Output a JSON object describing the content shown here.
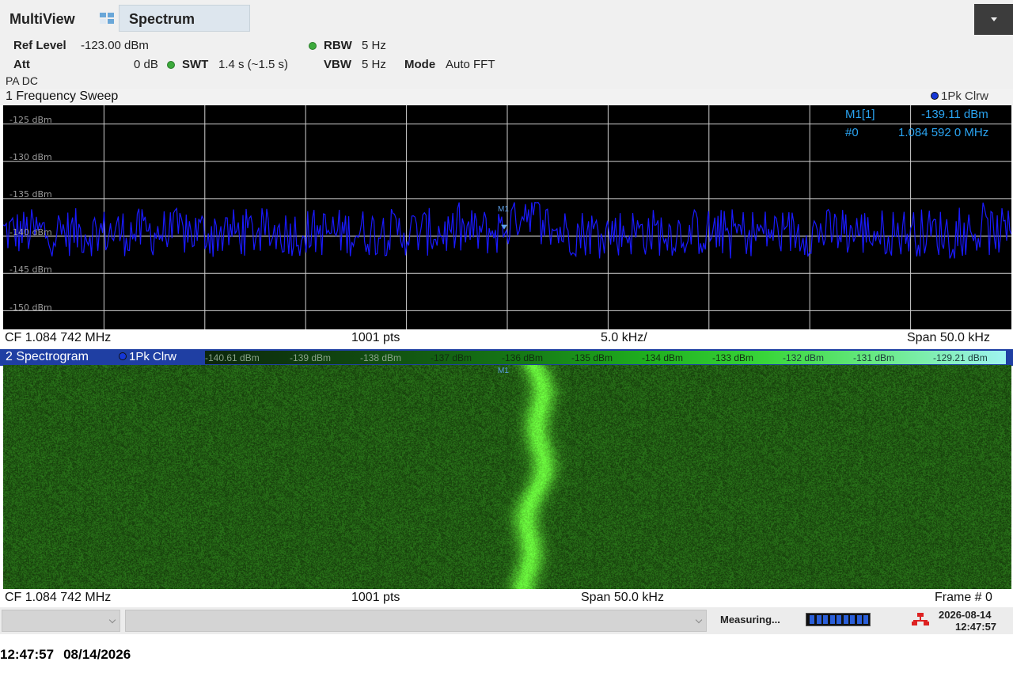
{
  "app": {
    "title": "MultiView",
    "active_tab": "Spectrum"
  },
  "settings": {
    "ref_level_label": "Ref Level",
    "ref_level_value": "-123.00 dBm",
    "att_label": "Att",
    "att_value": "0 dB",
    "swt_label": "SWT",
    "swt_value": "1.4 s (~1.5 s)",
    "rbw_label": "RBW",
    "rbw_value": "5 Hz",
    "vbw_label": "VBW",
    "vbw_value": "5 Hz",
    "mode_label": "Mode",
    "mode_value": "Auto FFT",
    "coupling": "PA DC"
  },
  "window1": {
    "title": "1 Frequency Sweep",
    "trace": "1Pk Clrw",
    "y_labels": [
      "-125 dBm",
      "-130 dBm",
      "-135 dBm",
      "-140 dBm",
      "-145 dBm",
      "-150 dBm"
    ],
    "marker": {
      "name": "M1[1]",
      "level": "-139.11 dBm",
      "index": "#0",
      "freq": "1.084 592 0 MHz",
      "label": "M1"
    },
    "footer": {
      "cf": "CF 1.084 742 MHz",
      "pts": "1001 pts",
      "div": "5.0 kHz/",
      "span": "Span 50.0 kHz"
    }
  },
  "window2": {
    "title": "2 Spectrogram",
    "trace": "1Pk Clrw",
    "colorbar_labels": [
      "-140.61 dBm",
      "-139 dBm",
      "-138 dBm",
      "-137 dBm",
      "-136 dBm",
      "-135 dBm",
      "-134 dBm",
      "-133 dBm",
      "-132 dBm",
      "-131 dBm",
      "-129.21 dBm"
    ],
    "marker_label": "M1",
    "footer": {
      "cf": "CF 1.084 742 MHz",
      "pts": "1001 pts",
      "span": "Span 50.0 kHz",
      "frame": "Frame # 0"
    }
  },
  "status": {
    "measuring": "Measuring...",
    "date": "2026-08-14",
    "time": "12:47:57"
  },
  "bottom": {
    "time": "12:47:57",
    "date": "08/14/2026"
  },
  "colors": {
    "trace": "#1a1aff",
    "plot_bg": "#000000",
    "grid": "#cfcfcf",
    "spectrogram_base": "#2c5a1d",
    "spectrogram_peak": "#7dff4a",
    "marker_info": "#2aa3f0",
    "window2_header": "#1f3fa3"
  },
  "chart_data": {
    "type": "line",
    "title": "1 Frequency Sweep",
    "xlabel": "",
    "ylabel": "",
    "x_center_mhz": 1.084742,
    "x_span_khz": 50.0,
    "points": 1001,
    "ylim": [
      -152.5,
      -122.5
    ],
    "y_ticks": [
      -125,
      -130,
      -135,
      -140,
      -145,
      -150
    ],
    "series": [
      {
        "name": "1Pk Clrw",
        "noise_floor": -139.5,
        "noise_range": [
          -143,
          -136
        ],
        "peak_offset_khz": 1.0,
        "peak_level": -135.8
      }
    ]
  }
}
